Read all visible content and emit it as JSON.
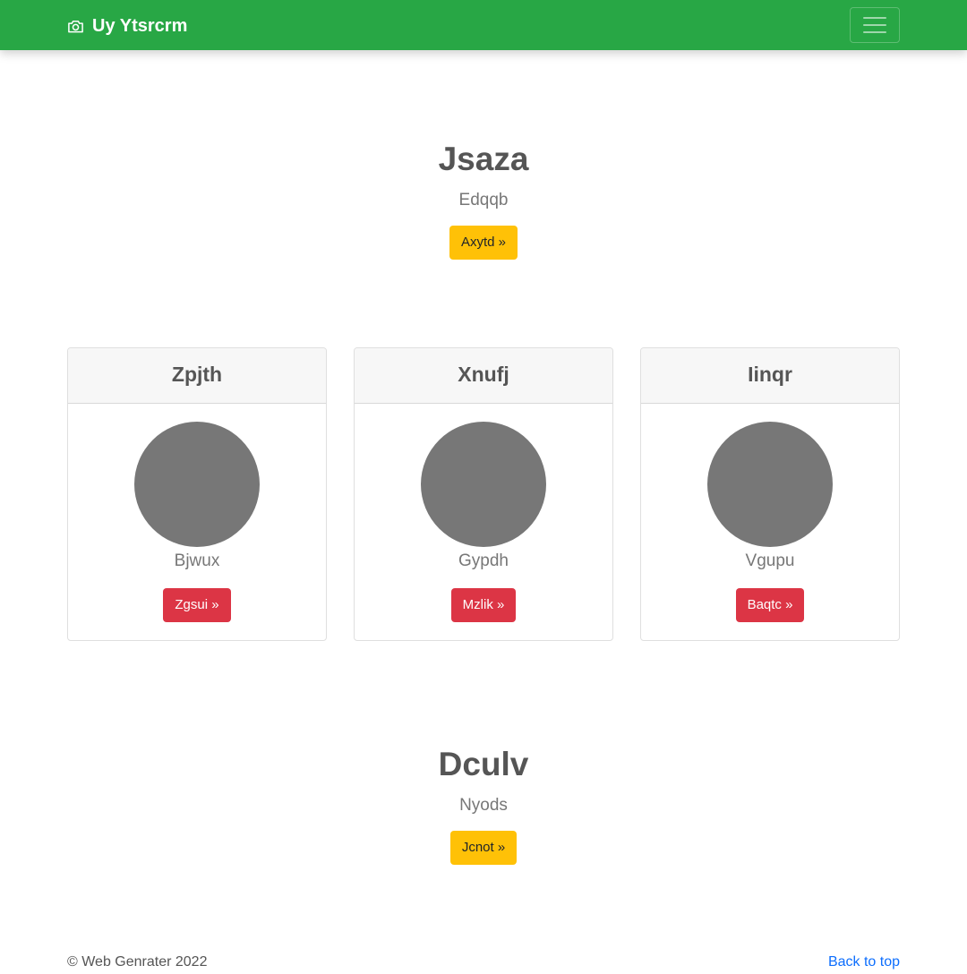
{
  "navbar": {
    "brand_label": "Uy Ytsrcrm",
    "brand_icon": "camera-icon",
    "toggler_icon": "hamburger-menu-icon",
    "background": "#28a745"
  },
  "hero_top": {
    "title": "Jsaza",
    "subtitle": "Edqqb",
    "button_label": "Axytd »"
  },
  "cards": [
    {
      "header": "Zpjth",
      "text": "Bjwux",
      "button_label": "Zgsui »"
    },
    {
      "header": "Xnufj",
      "text": "Gypdh",
      "button_label": "Mzlik »"
    },
    {
      "header": "Iinqr",
      "text": "Vgupu",
      "button_label": "Baqtc »"
    }
  ],
  "hero_bottom": {
    "title": "Dculv",
    "subtitle": "Nyods",
    "button_label": "Jcnot »"
  },
  "footer": {
    "copyright": "© Web Genrater 2022",
    "back_to_top": "Back to top"
  },
  "colors": {
    "primary_green": "#28a745",
    "warning": "#ffc107",
    "danger": "#dc3545",
    "link": "#0d6efd"
  }
}
